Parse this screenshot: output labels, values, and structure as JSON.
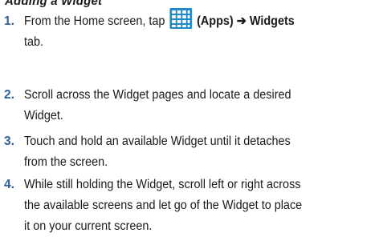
{
  "top_fragment": "Adding a Widget",
  "steps": [
    {
      "number": "1.",
      "pre": "From the Home screen, tap ",
      "icon": "apps-grid-icon",
      "icon_color": "#1e88c8",
      "apps_label": "(Apps)",
      "arrow": "➔",
      "widgets_label": "Widgets",
      "line2": "tab."
    },
    {
      "number": "2.",
      "line1": "Scroll across the Widget pages and locate a desired",
      "line2": "Widget."
    },
    {
      "number": "3.",
      "line1": "Touch and hold an available Widget until it detaches",
      "line2": "from the screen."
    },
    {
      "number": "4.",
      "line1": "While still holding the Widget, scroll left or right across",
      "line2": "the available screens and let go of the Widget to place",
      "line3": "it on your current screen."
    }
  ],
  "colors": {
    "step_number": "#2f5f95",
    "text": "#1a1a1a"
  }
}
